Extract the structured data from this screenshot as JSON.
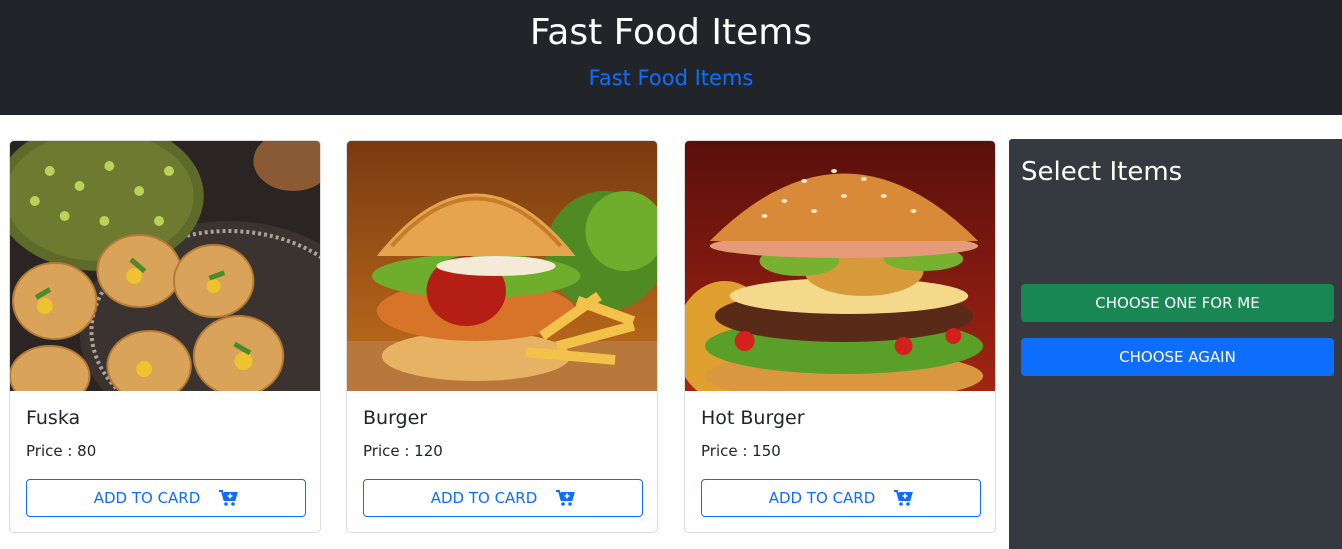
{
  "header": {
    "title": "Fast Food Items",
    "subtitle": "Fast Food Items"
  },
  "items": [
    {
      "name": "Fuska",
      "price": "Price : 80",
      "button_label": "ADD TO CARD",
      "image": "fuska-photo"
    },
    {
      "name": "Burger",
      "price": "Price : 120",
      "button_label": "ADD TO CARD",
      "image": "burger-fries-photo"
    },
    {
      "name": "Hot Burger",
      "price": "Price : 150",
      "button_label": "ADD TO CARD",
      "image": "hot-burger-photo"
    }
  ],
  "panel": {
    "title": "Select Items",
    "choose_label": "CHOOSE ONE FOR ME",
    "again_label": "CHOOSE AGAIN"
  },
  "colors": {
    "header_bg": "#212529",
    "accent": "#0d6efd",
    "panel_bg": "#343a40",
    "success": "#198754"
  }
}
